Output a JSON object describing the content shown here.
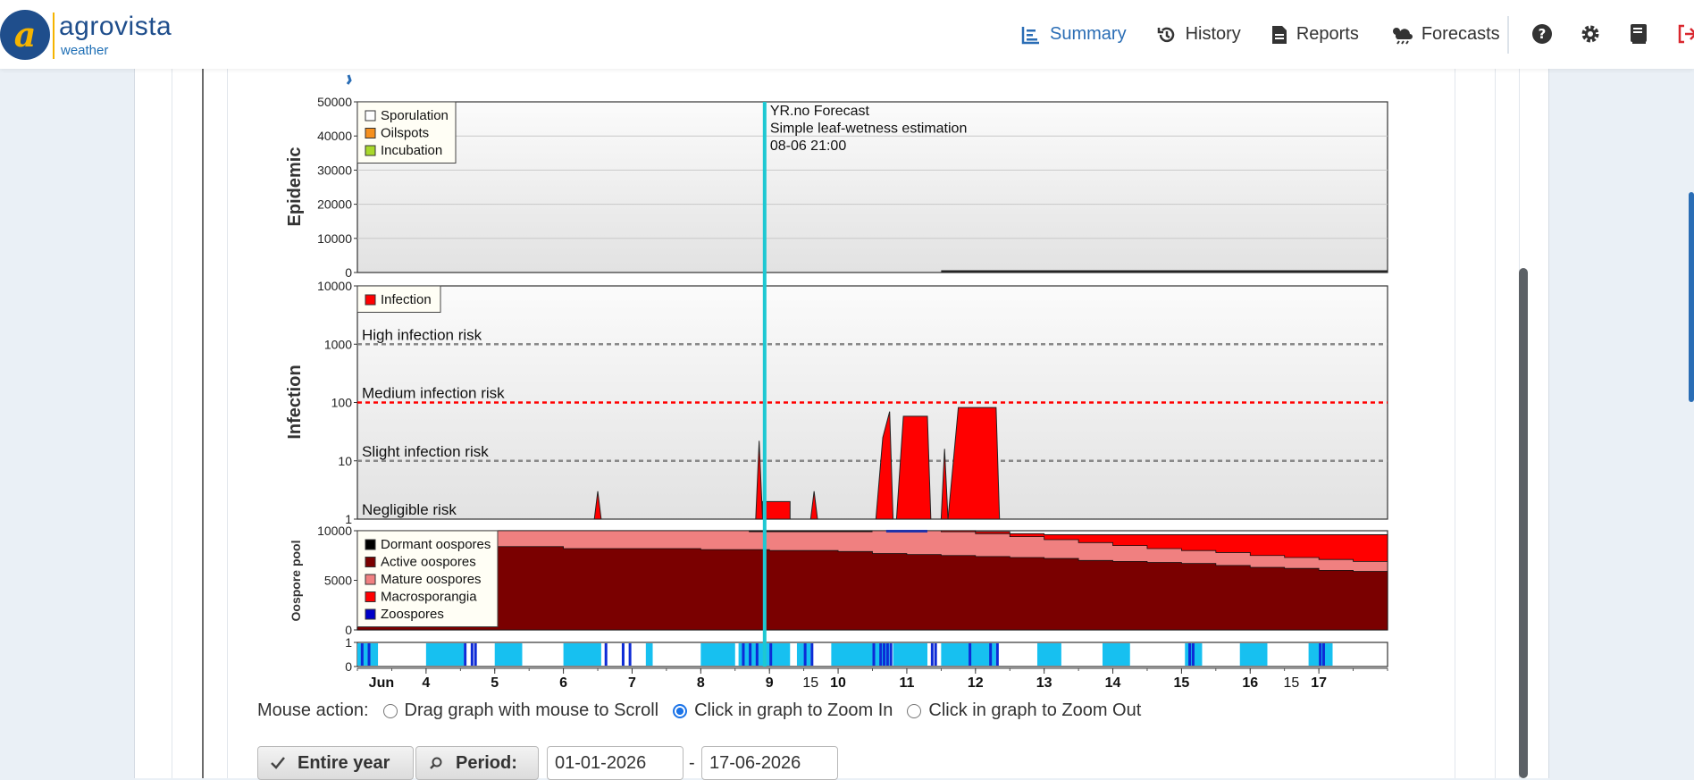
{
  "brand": {
    "name": "agrovista",
    "sub": "weather"
  },
  "nav": [
    {
      "label": "Summary",
      "icon": "chart-bars-icon",
      "active": true
    },
    {
      "label": "History",
      "icon": "history-icon",
      "active": false
    },
    {
      "label": "Reports",
      "icon": "document-icon",
      "active": false
    },
    {
      "label": "Forecasts",
      "icon": "cloud-sun-rain-icon",
      "active": false
    }
  ],
  "top_icons": [
    "help-icon",
    "settings-gear-icon",
    "book-icon",
    "logout-icon"
  ],
  "colors": {
    "accent": "#2a6db5",
    "cursor_line": "#1ec8d2",
    "infection": "#ff0000",
    "logout": "#d9272e"
  },
  "chart_data": [
    {
      "type": "area",
      "ylabel": "Epidemic",
      "yticks": [
        "50000",
        "40000",
        "30000",
        "20000",
        "10000",
        "0"
      ],
      "ylim": [
        0,
        50000
      ],
      "legend": [
        "Sporulation",
        "Oilspots",
        "Incubation"
      ],
      "legend_colors": [
        "#ffffff",
        "#f5901e",
        "#a8d82a"
      ],
      "annotation": [
        "YR.no Forecast",
        "Simple leaf-wetness estimation",
        "08-06 21:00"
      ],
      "x_days": [
        3,
        18
      ],
      "series": [
        {
          "name": "Sporulation",
          "x": [
            11.5,
            18
          ],
          "values": [
            0,
            0
          ]
        }
      ]
    },
    {
      "type": "area",
      "scale": "log",
      "ylabel": "Infection",
      "yticks": [
        "10000",
        "1000",
        "100",
        "10",
        "1"
      ],
      "ylim": [
        1,
        10000
      ],
      "legend": [
        "Infection"
      ],
      "legend_colors": [
        "#ff0000"
      ],
      "thresholds": [
        {
          "label": "High infection risk",
          "value": 1000,
          "color": "#888888"
        },
        {
          "label": "Medium infection risk",
          "value": 100,
          "color": "#ff0000"
        },
        {
          "label": "Slight infection risk",
          "value": 10,
          "color": "#888888"
        },
        {
          "label": "Negligible risk",
          "value": 1,
          "color": "#888888"
        }
      ],
      "series": [
        {
          "name": "Infection",
          "peaks": [
            {
              "x": [
                6.45,
                6.5,
                6.55
              ],
              "values": [
                1,
                3,
                1
              ]
            },
            {
              "x": [
                8.8,
                8.85,
                8.9
              ],
              "values": [
                1,
                22,
                1
              ]
            },
            {
              "x": [
                8.9,
                9.3
              ],
              "values": [
                2,
                2
              ]
            },
            {
              "x": [
                9.6,
                9.65,
                9.7
              ],
              "values": [
                1,
                3,
                1
              ]
            },
            {
              "x": [
                10.55,
                10.65,
                10.75,
                10.8
              ],
              "values": [
                1,
                25,
                70,
                1
              ]
            },
            {
              "x": [
                10.85,
                10.95,
                11.3,
                11.35
              ],
              "values": [
                1,
                58,
                58,
                1
              ]
            },
            {
              "x": [
                11.5,
                11.55,
                11.6
              ],
              "values": [
                1,
                16,
                1
              ]
            },
            {
              "x": [
                11.6,
                11.75,
                12.3,
                12.35
              ],
              "values": [
                1,
                82,
                82,
                1
              ]
            }
          ]
        }
      ]
    },
    {
      "type": "area",
      "ylabel": "Oospore pool",
      "yticks": [
        "10000",
        "5000",
        "0"
      ],
      "ylim": [
        0,
        10000
      ],
      "legend": [
        "Dormant oospores",
        "Active oospores",
        "Mature oospores",
        "Macrosporangia",
        "Zoospores"
      ],
      "legend_colors": [
        "#000000",
        "#7a0000",
        "#f08080",
        "#ff0000",
        "#0000c8"
      ],
      "x": [
        3,
        5,
        6,
        8,
        9,
        10,
        10.5,
        11,
        11.5,
        12,
        12.5,
        13,
        13.5,
        14,
        14.5,
        15,
        15.5,
        16,
        16.5,
        17,
        17.5,
        18
      ],
      "active": [
        8500,
        8400,
        8200,
        8100,
        8000,
        7900,
        7700,
        7600,
        7500,
        7400,
        7300,
        7200,
        7000,
        6900,
        6800,
        6700,
        6500,
        6300,
        6200,
        6000,
        5900,
        5800
      ],
      "mature_top": [
        10000,
        10000,
        10000,
        10000,
        10000,
        10000,
        10000,
        10000,
        9900,
        9700,
        9400,
        9100,
        8800,
        8500,
        8200,
        8000,
        7800,
        7500,
        7300,
        7100,
        6900,
        6700
      ],
      "macro_top": [
        10000,
        10000,
        10000,
        10000,
        10000,
        10000,
        10000,
        10000,
        10000,
        9900,
        9700,
        9600,
        9600,
        9600,
        9600,
        9600,
        9600,
        9600,
        9600,
        9600,
        9600,
        9600
      ]
    },
    {
      "type": "bar",
      "yticks": [
        "1",
        "0"
      ],
      "ylim": [
        0,
        1
      ],
      "light_segments": [
        [
          3,
          3.3
        ],
        [
          4,
          4.55
        ],
        [
          5,
          5.4
        ],
        [
          6,
          6.55
        ],
        [
          7.2,
          7.3
        ],
        [
          8,
          8.5
        ],
        [
          8.55,
          9.3
        ],
        [
          9.4,
          9.6
        ],
        [
          9.9,
          10.75
        ],
        [
          10.8,
          11.3
        ],
        [
          11.5,
          12.3
        ],
        [
          12.9,
          13.25
        ],
        [
          13.85,
          14.25
        ],
        [
          15.05,
          15.3
        ],
        [
          15.85,
          16.25
        ],
        [
          16.85,
          17.2
        ]
      ],
      "dark_ticks": [
        3.05,
        3.15,
        4.55,
        4.65,
        4.7,
        6.6,
        6.85,
        6.95,
        8.6,
        8.7,
        8.8,
        9.0,
        9.5,
        9.6,
        10.5,
        10.6,
        10.65,
        10.7,
        10.75,
        11.35,
        11.4,
        11.9,
        12.2,
        12.3,
        15.1,
        15.15,
        17.0,
        17.05
      ]
    }
  ],
  "xaxis": {
    "month": "Jun",
    "days": [
      "4",
      "5",
      "6",
      "7",
      "8",
      "9",
      "10",
      "11",
      "12",
      "13",
      "14",
      "15",
      "16",
      "17"
    ],
    "minor_labels": [
      {
        "day": 9.6,
        "label": "15"
      },
      {
        "day": 16.6,
        "label": "15"
      }
    ]
  },
  "cursor_day": 8.93,
  "mouse_action": {
    "label": "Mouse action:",
    "options": [
      {
        "label": "Drag graph with mouse to Scroll",
        "selected": false
      },
      {
        "label": "Click in graph to Zoom In",
        "selected": true
      },
      {
        "label": "Click in graph to Zoom Out",
        "selected": false
      }
    ]
  },
  "period": {
    "entire_year_label": "Entire year",
    "period_label": "Period:",
    "from": "01-01-2026",
    "to": "17-06-2026",
    "separator": "-"
  }
}
